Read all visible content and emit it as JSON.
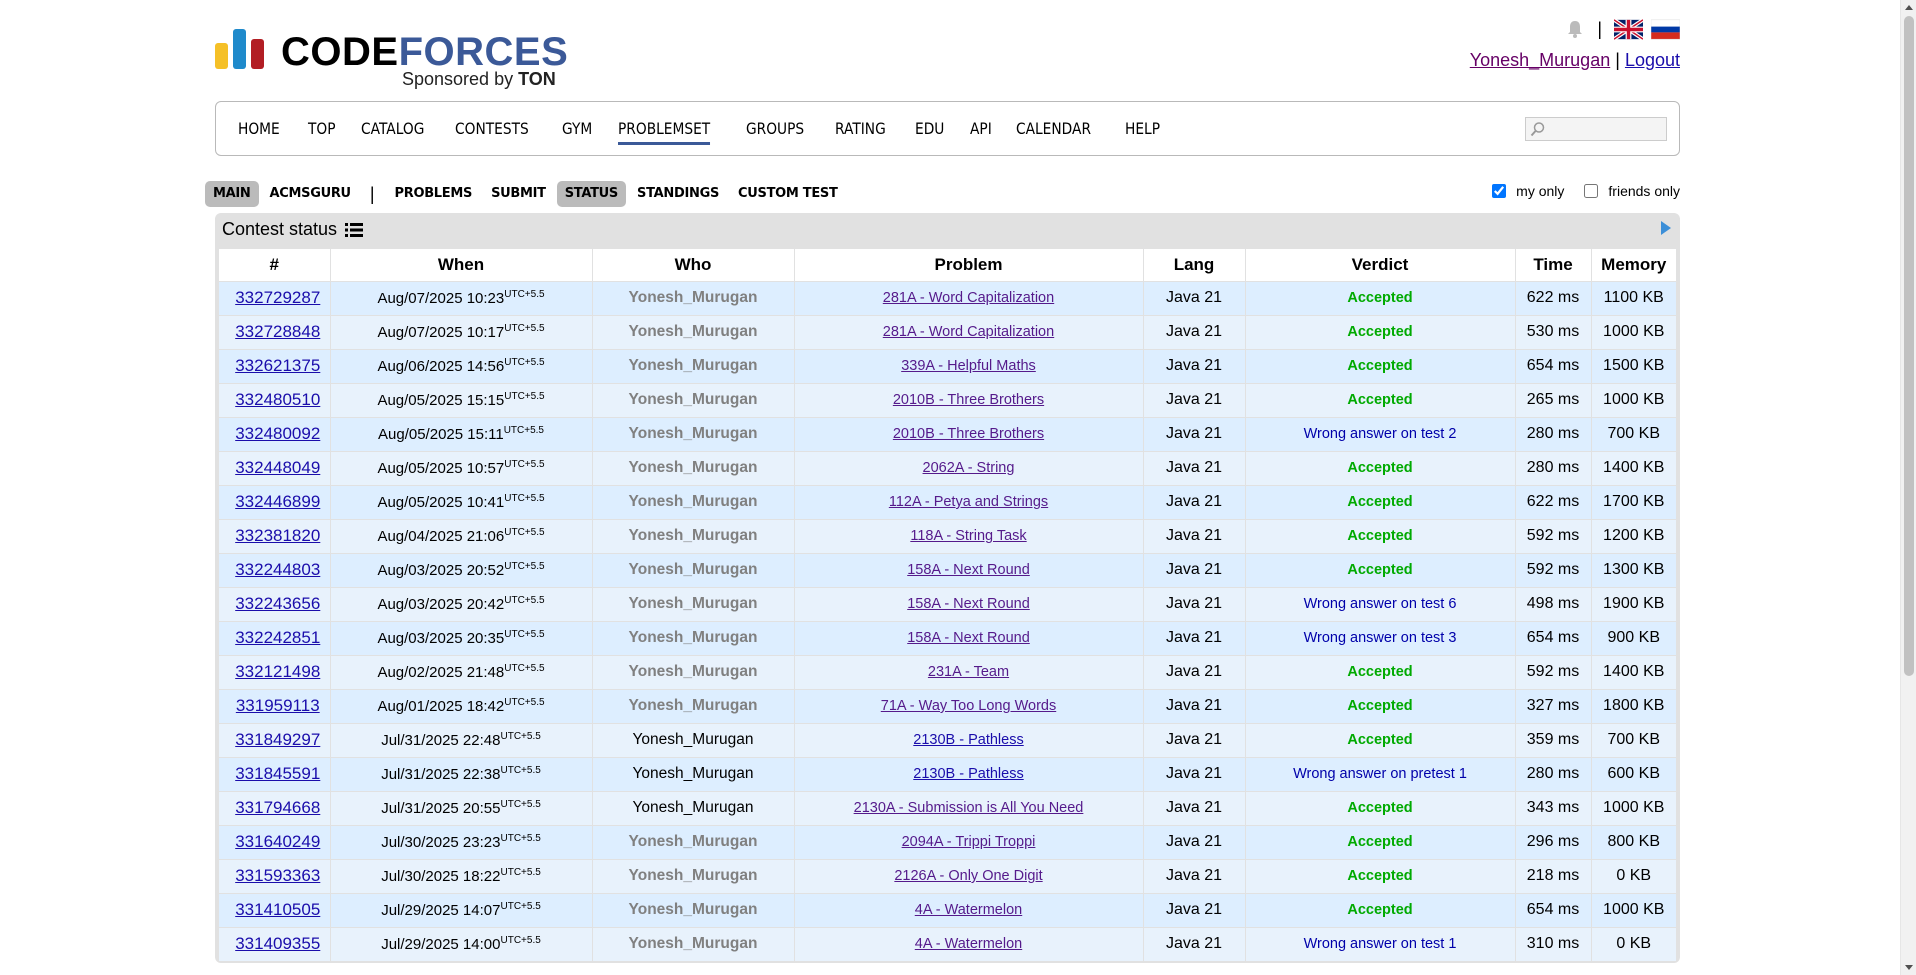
{
  "header": {
    "logo_code": "CODE",
    "logo_forces": "FORCES",
    "sponsor_prefix": "Sponsored by",
    "sponsor_name": "TON",
    "username": "Yonesh_Murugan",
    "separator": "|",
    "logout": "Logout"
  },
  "menu": {
    "items": [
      "HOME",
      "TOP",
      "CATALOG",
      "CONTESTS",
      "GYM",
      "PROBLEMSET",
      "GROUPS",
      "RATING",
      "EDU",
      "API",
      "CALENDAR",
      "HELP"
    ],
    "active": "PROBLEMSET",
    "search_placeholder": ""
  },
  "submenu": {
    "items": [
      "MAIN",
      "ACMSGURU",
      "PROBLEMS",
      "SUBMIT",
      "STATUS",
      "STANDINGS",
      "CUSTOM TEST"
    ],
    "separator": "|",
    "filter_my_only": "my only",
    "filter_friends_only": "friends only",
    "my_only_checked": true,
    "friends_only_checked": false
  },
  "status": {
    "title": "Contest status",
    "columns": [
      "#",
      "When",
      "Who",
      "Problem",
      "Lang",
      "Verdict",
      "Time",
      "Memory"
    ],
    "tz": "UTC+5.5",
    "rows": [
      {
        "id": "332729287",
        "when": "Aug/07/2025 10:23",
        "who": "Yonesh_Murugan",
        "who_style": "bold",
        "problem": "281A - Word Capitalization",
        "visited": true,
        "lang": "Java 21",
        "verdict": "Accepted",
        "time": "622 ms",
        "memory": "1100 KB"
      },
      {
        "id": "332728848",
        "when": "Aug/07/2025 10:17",
        "who": "Yonesh_Murugan",
        "who_style": "bold",
        "problem": "281A - Word Capitalization",
        "visited": true,
        "lang": "Java 21",
        "verdict": "Accepted",
        "time": "530 ms",
        "memory": "1000 KB"
      },
      {
        "id": "332621375",
        "when": "Aug/06/2025 14:56",
        "who": "Yonesh_Murugan",
        "who_style": "bold",
        "problem": "339A - Helpful Maths",
        "visited": true,
        "lang": "Java 21",
        "verdict": "Accepted",
        "time": "654 ms",
        "memory": "1500 KB"
      },
      {
        "id": "332480510",
        "when": "Aug/05/2025 15:15",
        "who": "Yonesh_Murugan",
        "who_style": "bold",
        "problem": "2010B - Three Brothers",
        "visited": true,
        "lang": "Java 21",
        "verdict": "Accepted",
        "time": "265 ms",
        "memory": "1000 KB"
      },
      {
        "id": "332480092",
        "when": "Aug/05/2025 15:11",
        "who": "Yonesh_Murugan",
        "who_style": "bold",
        "problem": "2010B - Three Brothers",
        "visited": true,
        "lang": "Java 21",
        "verdict": "Wrong answer on test 2",
        "time": "280 ms",
        "memory": "700 KB"
      },
      {
        "id": "332448049",
        "when": "Aug/05/2025 10:57",
        "who": "Yonesh_Murugan",
        "who_style": "bold",
        "problem": "2062A - String",
        "visited": true,
        "lang": "Java 21",
        "verdict": "Accepted",
        "time": "280 ms",
        "memory": "1400 KB"
      },
      {
        "id": "332446899",
        "when": "Aug/05/2025 10:41",
        "who": "Yonesh_Murugan",
        "who_style": "bold",
        "problem": "112A - Petya and Strings",
        "visited": true,
        "lang": "Java 21",
        "verdict": "Accepted",
        "time": "622 ms",
        "memory": "1700 KB"
      },
      {
        "id": "332381820",
        "when": "Aug/04/2025 21:06",
        "who": "Yonesh_Murugan",
        "who_style": "bold",
        "problem": "118A - String Task",
        "visited": true,
        "lang": "Java 21",
        "verdict": "Accepted",
        "time": "592 ms",
        "memory": "1200 KB"
      },
      {
        "id": "332244803",
        "when": "Aug/03/2025 20:52",
        "who": "Yonesh_Murugan",
        "who_style": "bold",
        "problem": "158A - Next Round",
        "visited": true,
        "lang": "Java 21",
        "verdict": "Accepted",
        "time": "592 ms",
        "memory": "1300 KB"
      },
      {
        "id": "332243656",
        "when": "Aug/03/2025 20:42",
        "who": "Yonesh_Murugan",
        "who_style": "bold",
        "problem": "158A - Next Round",
        "visited": true,
        "lang": "Java 21",
        "verdict": "Wrong answer on test 6",
        "time": "498 ms",
        "memory": "1900 KB"
      },
      {
        "id": "332242851",
        "when": "Aug/03/2025 20:35",
        "who": "Yonesh_Murugan",
        "who_style": "bold",
        "problem": "158A - Next Round",
        "visited": true,
        "lang": "Java 21",
        "verdict": "Wrong answer on test 3",
        "time": "654 ms",
        "memory": "900 KB"
      },
      {
        "id": "332121498",
        "when": "Aug/02/2025 21:48",
        "who": "Yonesh_Murugan",
        "who_style": "bold",
        "problem": "231A - Team",
        "visited": true,
        "lang": "Java 21",
        "verdict": "Accepted",
        "time": "592 ms",
        "memory": "1400 KB"
      },
      {
        "id": "331959113",
        "when": "Aug/01/2025 18:42",
        "who": "Yonesh_Murugan",
        "who_style": "bold",
        "problem": "71A - Way Too Long Words",
        "visited": true,
        "lang": "Java 21",
        "verdict": "Accepted",
        "time": "327 ms",
        "memory": "1800 KB"
      },
      {
        "id": "331849297",
        "when": "Jul/31/2025 22:48",
        "who": "Yonesh_Murugan",
        "who_style": "plain",
        "problem": "2130B - Pathless",
        "visited": false,
        "lang": "Java 21",
        "verdict": "Accepted",
        "time": "359 ms",
        "memory": "700 KB"
      },
      {
        "id": "331845591",
        "when": "Jul/31/2025 22:38",
        "who": "Yonesh_Murugan",
        "who_style": "plain",
        "problem": "2130B - Pathless",
        "visited": false,
        "lang": "Java 21",
        "verdict": "Wrong answer on pretest 1",
        "time": "280 ms",
        "memory": "600 KB"
      },
      {
        "id": "331794668",
        "when": "Jul/31/2025 20:55",
        "who": "Yonesh_Murugan",
        "who_style": "plain",
        "problem": "2130A - Submission is All You Need",
        "visited": true,
        "lang": "Java 21",
        "verdict": "Accepted",
        "time": "343 ms",
        "memory": "1000 KB"
      },
      {
        "id": "331640249",
        "when": "Jul/30/2025 23:23",
        "who": "Yonesh_Murugan",
        "who_style": "bold",
        "problem": "2094A - Trippi Troppi",
        "visited": true,
        "lang": "Java 21",
        "verdict": "Accepted",
        "time": "296 ms",
        "memory": "800 KB"
      },
      {
        "id": "331593363",
        "when": "Jul/30/2025 18:22",
        "who": "Yonesh_Murugan",
        "who_style": "bold",
        "problem": "2126A - Only One Digit",
        "visited": true,
        "lang": "Java 21",
        "verdict": "Accepted",
        "time": "218 ms",
        "memory": "0 KB"
      },
      {
        "id": "331410505",
        "when": "Jul/29/2025 14:07",
        "who": "Yonesh_Murugan",
        "who_style": "bold",
        "problem": "4A - Watermelon",
        "visited": true,
        "lang": "Java 21",
        "verdict": "Accepted",
        "time": "654 ms",
        "memory": "1000 KB"
      },
      {
        "id": "331409355",
        "when": "Jul/29/2025 14:00",
        "who": "Yonesh_Murugan",
        "who_style": "bold",
        "problem": "4A - Watermelon",
        "visited": true,
        "lang": "Java 21",
        "verdict": "Wrong answer on test 1",
        "time": "310 ms",
        "memory": "0 KB"
      }
    ]
  },
  "colors": {
    "brand_blue": "#3b5998",
    "accepted": "#00aa00",
    "wrong_answer": "#0000aa",
    "row_bg": "#ddeeff",
    "visited_link": "#551a8b",
    "link": "#1a0dab"
  }
}
